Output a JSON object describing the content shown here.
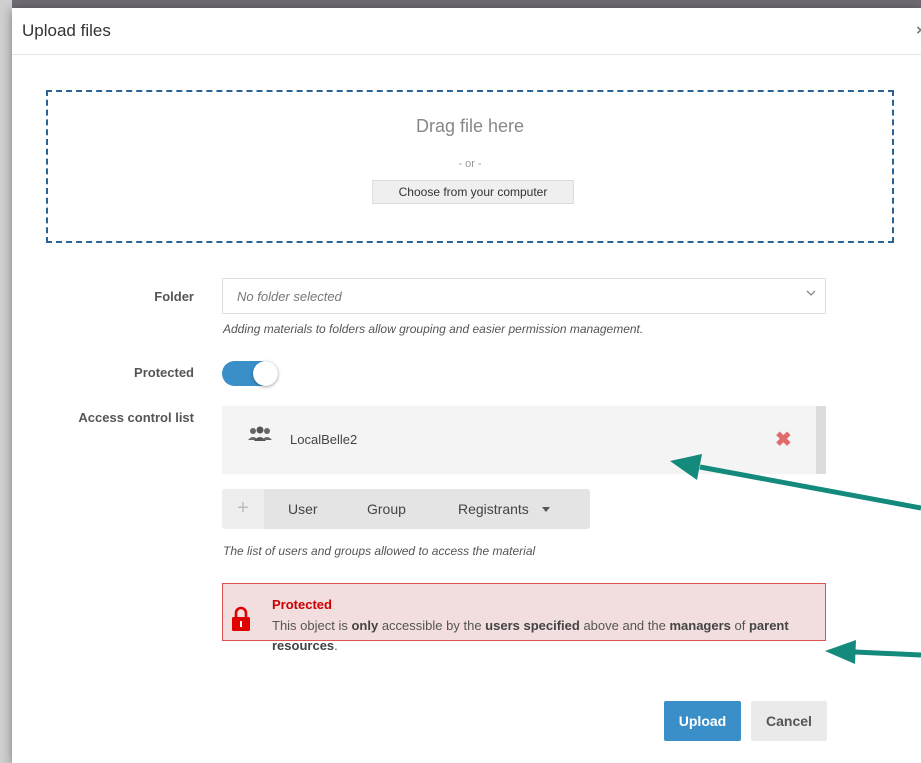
{
  "dialog": {
    "title": "Upload files",
    "close_symbol": "×"
  },
  "dropzone": {
    "title": "Drag file here",
    "or_text": "- or -",
    "choose_label": "Choose from your computer"
  },
  "folder": {
    "label": "Folder",
    "placeholder": "No folder selected",
    "help": "Adding materials to folders allow grouping and easier permission management."
  },
  "protected": {
    "label": "Protected",
    "enabled": true
  },
  "acl": {
    "label": "Access control list",
    "entries": [
      {
        "name": "LocalBelle2",
        "icon": "group-icon",
        "remove_icon": "remove-icon"
      }
    ],
    "add_options": [
      "User",
      "Group",
      "Registrants"
    ],
    "add_icon": "plus-icon",
    "help": "The list of users and groups allowed to access the material"
  },
  "alert": {
    "title": "Protected",
    "body_parts": [
      "This object is ",
      "only",
      " accessible by the ",
      "users specified",
      " above and the ",
      "managers",
      " of ",
      "parent resources",
      "."
    ]
  },
  "actions": {
    "upload": "Upload",
    "cancel": "Cancel"
  },
  "colors": {
    "primary": "#3a8fc9",
    "danger": "#d9534f",
    "arrow": "#138a7c"
  }
}
